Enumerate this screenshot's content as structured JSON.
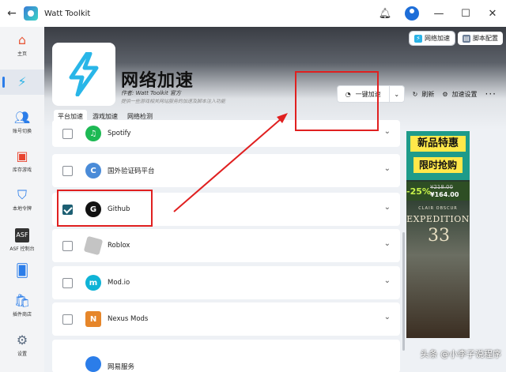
{
  "window": {
    "title": "Watt Toolkit"
  },
  "sidebar": {
    "items": [
      {
        "label": "主页",
        "icon": "home-icon"
      },
      {
        "label": "",
        "icon": "lightning-icon"
      },
      {
        "label": "账号切换",
        "icon": "users-icon"
      },
      {
        "label": "库存游戏",
        "icon": "library-icon"
      },
      {
        "label": "本地令牌",
        "icon": "shield-icon"
      },
      {
        "label": "ASF 控制台",
        "icon": "asf-icon"
      },
      {
        "label": "",
        "icon": "cards-icon"
      },
      {
        "label": "插件商店",
        "icon": "store-icon"
      },
      {
        "label": "设置",
        "icon": "gear-icon"
      }
    ]
  },
  "top_tabs": [
    {
      "label": "网络加速"
    },
    {
      "label": "脚本配置"
    }
  ],
  "hero": {
    "title": "网络加速",
    "author": "作者: Watt Toolkit 官方",
    "description": "提供一些游戏相关网站服务的加速及脚本注入功能"
  },
  "actions": {
    "accelerate": "一键加速",
    "refresh": "刷新",
    "settings": "加速设置",
    "more": "···"
  },
  "subtabs": [
    {
      "label": "平台加速"
    },
    {
      "label": "游戏加速"
    },
    {
      "label": "网络检测"
    }
  ],
  "rows": [
    {
      "name": "Spotify",
      "checked": false,
      "color": "#1db954",
      "glyph": "♫"
    },
    {
      "name": "国外验证码平台",
      "checked": false,
      "color": "#4a8bd8",
      "glyph": "C"
    },
    {
      "name": "Github",
      "checked": true,
      "color": "#111111",
      "glyph": "G"
    },
    {
      "name": "Roblox",
      "checked": false,
      "color": "#bbbbbb",
      "glyph": ""
    },
    {
      "name": "Mod.io",
      "checked": false,
      "color": "#0fb3d6",
      "glyph": "m"
    },
    {
      "name": "Nexus Mods",
      "checked": false,
      "color": "#e6862a",
      "glyph": "N"
    },
    {
      "name": "网易服务",
      "checked": false,
      "color": "#2b7de9",
      "glyph": ""
    }
  ],
  "ad": {
    "line1": "新品特惠",
    "line2": "限时抢购",
    "discount": "-25%",
    "old_price": "¥218.00",
    "new_price": "¥164.00",
    "subtitle": "CLAIR OBSCUR",
    "game": "EXPEDITION",
    "number": "33"
  },
  "watermark": "头条 @小李子说程序",
  "colors": {
    "accent": "#2b7de9",
    "annotation": "#e02020"
  }
}
